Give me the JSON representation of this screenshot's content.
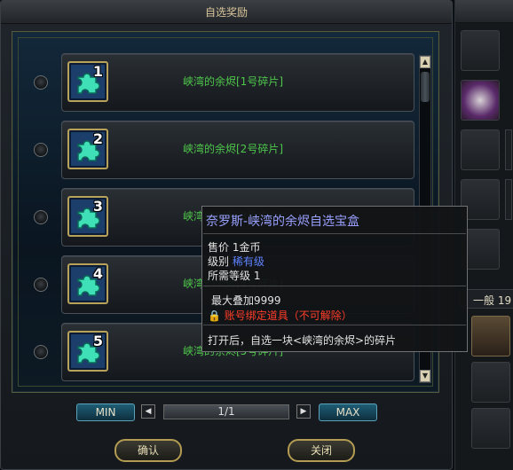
{
  "dialog": {
    "title": "自选奖励",
    "rows": [
      {
        "number": "1",
        "label": "峡湾的余烬[1号碎片]"
      },
      {
        "number": "2",
        "label": "峡湾的余烬[2号碎片]"
      },
      {
        "number": "3",
        "label": "峡湾的余烬[3号碎片]"
      },
      {
        "number": "4",
        "label": "峡湾的余烬[4号碎片]"
      },
      {
        "number": "5",
        "label": "峡湾的余烬[5号碎片]"
      }
    ],
    "min_label": "MIN",
    "max_label": "MAX",
    "page": "1/1",
    "confirm_label": "确认",
    "close_label": "关闭"
  },
  "tooltip": {
    "title": "奈罗斯-峡湾的余烬自选宝盒",
    "price_label": "售价",
    "price_value": "1金币",
    "grade_label": "级别",
    "grade_value": "稀有级",
    "level_label": "所需等级",
    "level_value": "1",
    "stack": "最大叠加9999",
    "binding": "账号绑定道具（不可解除）",
    "description": "打开后，自选一块<峡湾的余烬>的碎片"
  },
  "side_panel": {
    "tab_label": "一般 19"
  },
  "colors": {
    "item_green": "#4ec64a",
    "tooltip_title": "#9aa0ff",
    "rare_blue": "#5f82ff",
    "bound_red": "#ff3d2a"
  }
}
